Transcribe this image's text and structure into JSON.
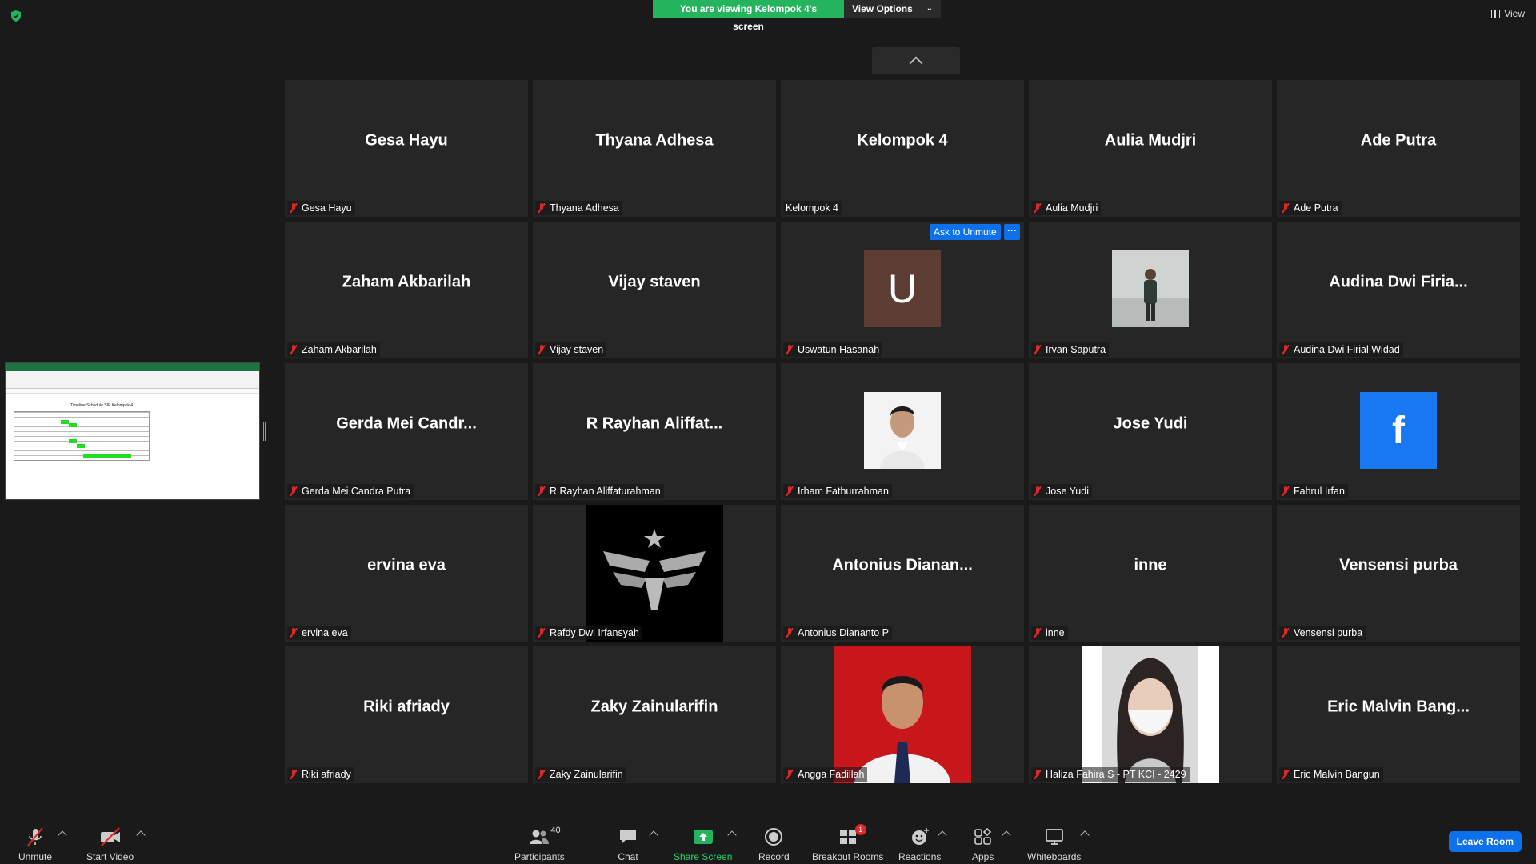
{
  "banner": {
    "viewing_text": "You are viewing Kelompok 4's screen",
    "view_options": "View Options",
    "view_label": "View"
  },
  "tiles": [
    {
      "big": "Gesa Hayu",
      "name": "Gesa Hayu",
      "muted": true,
      "kind": "text"
    },
    {
      "big": "Thyana Adhesa",
      "name": "Thyana Adhesa",
      "muted": true,
      "kind": "text"
    },
    {
      "big": "Kelompok 4",
      "name": "Kelompok 4",
      "muted": false,
      "kind": "text"
    },
    {
      "big": "Aulia Mudjri",
      "name": "Aulia Mudjri",
      "muted": true,
      "kind": "text"
    },
    {
      "big": "Ade Putra",
      "name": "Ade Putra",
      "muted": true,
      "kind": "text"
    },
    {
      "big": "Zaham Akbarilah",
      "name": "Zaham Akbarilah",
      "muted": true,
      "kind": "text"
    },
    {
      "big": "Vijay staven",
      "name": "Vijay staven",
      "muted": true,
      "kind": "text"
    },
    {
      "big": "U",
      "name": "Uswatun Hasanah",
      "muted": true,
      "kind": "letter"
    },
    {
      "big": "",
      "name": "Irvan Saputra",
      "muted": true,
      "kind": "photo-outdoor"
    },
    {
      "big": "Audina  Dwi  Firia...",
      "name": "Audina Dwi Firial Widad",
      "muted": true,
      "kind": "text"
    },
    {
      "big": "Gerda Mei Candr...",
      "name": "Gerda Mei Candra Putra",
      "muted": true,
      "kind": "text"
    },
    {
      "big": "R  Rayhan  Aliffat...",
      "name": "R Rayhan Aliffaturahman",
      "muted": true,
      "kind": "text"
    },
    {
      "big": "",
      "name": "Irham Fathurrahman",
      "muted": true,
      "kind": "photo-portrait"
    },
    {
      "big": "Jose Yudi",
      "name": "Jose Yudi",
      "muted": true,
      "kind": "text"
    },
    {
      "big": "f",
      "name": "Fahrul Irfan",
      "muted": true,
      "kind": "fb"
    },
    {
      "big": "ervina eva",
      "name": "ervina eva",
      "muted": true,
      "kind": "text"
    },
    {
      "big": "",
      "name": "Rafdy Dwi Irfansyah",
      "muted": true,
      "kind": "logo"
    },
    {
      "big": "Antonius  Dianan...",
      "name": "Antonius Diananto P",
      "muted": true,
      "kind": "text"
    },
    {
      "big": "inne",
      "name": "inne",
      "muted": true,
      "kind": "text"
    },
    {
      "big": "Vensensi purba",
      "name": "Vensensi purba",
      "muted": true,
      "kind": "text"
    },
    {
      "big": "Riki afriady",
      "name": "Riki afriady",
      "muted": true,
      "kind": "text"
    },
    {
      "big": "Zaky Zainularifin",
      "name": "Zaky Zainularifin",
      "muted": true,
      "kind": "text"
    },
    {
      "big": "",
      "name": "Angga Fadillah",
      "muted": true,
      "kind": "photo-red"
    },
    {
      "big": "",
      "name": "Haliza Fahira S - PT KCI - 2429",
      "muted": true,
      "kind": "photo-mask"
    },
    {
      "big": "Eric Malvin Bang...",
      "name": "Eric Malvin Bangun",
      "muted": true,
      "kind": "text"
    }
  ],
  "ask_unmute": "Ask to Unmute",
  "ask_more": "···",
  "toolbar": {
    "unmute": "Unmute",
    "start_video": "Start Video",
    "participants": "Participants",
    "participants_count": "40",
    "chat": "Chat",
    "share_screen": "Share Screen",
    "record": "Record",
    "breakout_rooms": "Breakout Rooms",
    "breakout_badge": "1",
    "reactions": "Reactions",
    "apps": "Apps",
    "whiteboards": "Whiteboards",
    "leave_room": "Leave Room"
  },
  "shared_screen": {
    "sheet_title": "Timeline Schedule SIP Kelompok 4"
  },
  "colors": {
    "accent_blue": "#0e71eb",
    "share_green": "#23b45d",
    "muted_red": "#e02828",
    "tile_bg": "#262626",
    "bg": "#1a1a1a"
  }
}
